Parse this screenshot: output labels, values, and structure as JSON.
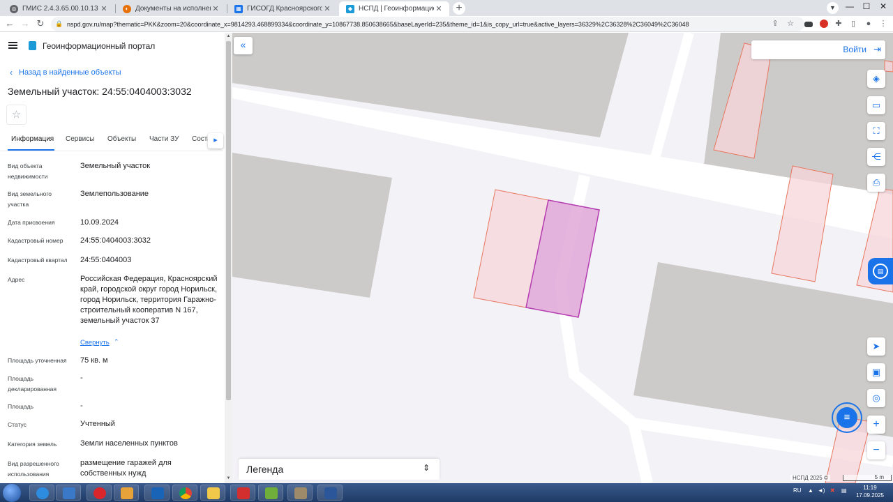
{
  "browser": {
    "tabs": [
      {
        "label": "ГМИС 2.4.3.65.00.10.13",
        "active": false
      },
      {
        "label": "Документы на исполнении",
        "active": false
      },
      {
        "label": "ГИСОГД Красноярского края",
        "active": false
      },
      {
        "label": "НСПД | Геоинформационный п",
        "active": true
      }
    ],
    "tab_close": "✕",
    "new_tab": "+",
    "url": "nspd.gov.ru/map?thematic=PKK&zoom=20&coordinate_x=9814293.468899334&coordinate_y=10867738.850638665&baseLayerId=235&theme_id=1&is_copy_url=true&active_layers=36329%2C36328%2C36049%2C36048",
    "window_controls": {
      "minimize": "—",
      "maximize": "☐",
      "close": "✕"
    }
  },
  "portal": {
    "title": "Геоинформационный портал"
  },
  "panel": {
    "back_link": "Назад в найденные объекты",
    "parcel_title": "Земельный участок: 24:55:0404003:3032",
    "star": "☆",
    "tabs": [
      "Информация",
      "Сервисы",
      "Объекты",
      "Части ЗУ",
      "Соста"
    ],
    "fields": [
      {
        "label": "Вид объекта недвижимости",
        "value": "Земельный участок"
      },
      {
        "label": "Вид земельного участка",
        "value": "Землепользование"
      },
      {
        "label": "Дата присвоения",
        "value": "10.09.2024"
      },
      {
        "label": "Кадастровый номер",
        "value": "24:55:0404003:3032"
      },
      {
        "label": "Кадастровый квартал",
        "value": "24:55:0404003"
      },
      {
        "label": "Адрес",
        "value": "Российская Федерация, Красноярский край, городской округ город Норильск, город Норильск, территория Гаражно-строительный кооператив N 167, земельный участок 37"
      },
      {
        "label": "Площадь уточненная",
        "value": "75 кв. м"
      },
      {
        "label": "Площадь декларированная",
        "value": "-"
      },
      {
        "label": "Площадь",
        "value": "-"
      },
      {
        "label": "Статус",
        "value": "Учтенный"
      },
      {
        "label": "Категория земель",
        "value": "Земли населенных пунктов"
      },
      {
        "label": "Вид разрешенного использования",
        "value": "размещение гаражей для собственных нужд"
      }
    ],
    "collapse_link": "Свернуть"
  },
  "map": {
    "login_label": "Войти",
    "legend_label": "Легенда",
    "attribution": "НСПД 2025 ©",
    "scale_label": "5 m",
    "colors": {
      "background": "#f3f2f7",
      "building": "#cdcbc9",
      "road": "#ffffff",
      "parcel_fill": "#f7d6d9",
      "parcel_stroke": "#e8765e",
      "selected_fill": "#e0a8d8",
      "selected_stroke": "#b43bb0",
      "accent": "#1a73e8"
    },
    "tools": [
      "layers-icon",
      "ruler-icon",
      "area-select-icon",
      "share-icon",
      "print-icon"
    ]
  },
  "taskbar": {
    "language": "RU",
    "time": "11:19",
    "date": "17.09.2025"
  }
}
